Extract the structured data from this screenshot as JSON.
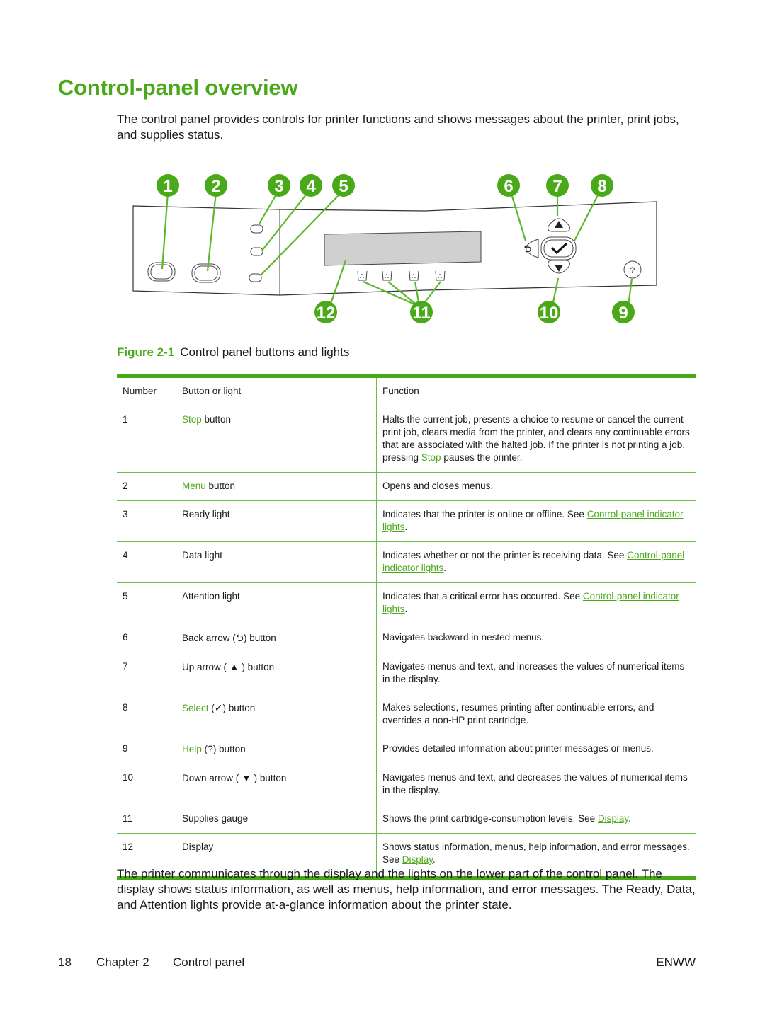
{
  "heading": "Control-panel overview",
  "intro": "The control panel provides controls for printer functions and shows messages about the printer, print jobs, and supplies status.",
  "diagram": {
    "callouts": [
      "1",
      "2",
      "3",
      "4",
      "5",
      "6",
      "7",
      "8",
      "9",
      "10",
      "11",
      "12"
    ],
    "help_symbol": "?"
  },
  "figure": {
    "label": "Figure 2-1",
    "caption": "Control panel buttons and lights"
  },
  "table": {
    "headers": [
      "Number",
      "Button or light",
      "Function"
    ],
    "rows": [
      {
        "num": "1",
        "name_green": "Stop",
        "name_rest": " button",
        "func": "Halts the current job, presents a choice to resume or cancel the current print job, clears media from the printer, and clears any continuable errors that are associated with the halted job. If the printer is not printing a job, pressing ",
        "func_green": "Stop",
        "func_tail": " pauses the printer."
      },
      {
        "num": "2",
        "name_green": "Menu",
        "name_rest": " button",
        "func": "Opens and closes menus."
      },
      {
        "num": "3",
        "name": "Ready light",
        "func": "Indicates that the printer is online or offline. See ",
        "func_link": "Control-panel indicator lights",
        "func_tail": "."
      },
      {
        "num": "4",
        "name": "Data light",
        "func": "Indicates whether or not the printer is receiving data. See ",
        "func_link": "Control-panel indicator lights",
        "func_tail": "."
      },
      {
        "num": "5",
        "name": "Attention light",
        "func": "Indicates that a critical error has occurred. See ",
        "func_link": "Control-panel indicator lights",
        "func_tail": "."
      },
      {
        "num": "6",
        "name_pre": "Back arrow (",
        "glyph": "⮌",
        "name_post": ") button",
        "func": "Navigates backward in nested menus."
      },
      {
        "num": "7",
        "name_pre": "Up arrow ( ",
        "glyph": "▲",
        "name_post": " ) button",
        "func": "Navigates menus and text, and increases the values of numerical items in the display."
      },
      {
        "num": "8",
        "name_green": "Select",
        "name_pre": " (",
        "glyph": "✓",
        "name_post": ") button",
        "func": "Makes selections, resumes printing after continuable errors, and overrides a non-HP print cartridge."
      },
      {
        "num": "9",
        "name_green": "Help",
        "name_pre": " (",
        "glyph": "?",
        "name_post": ") button",
        "func": "Provides detailed information about printer messages or menus."
      },
      {
        "num": "10",
        "name_pre": "Down arrow ( ",
        "glyph": "▼",
        "name_post": " ) button",
        "func": "Navigates menus and text, and decreases the values of numerical items in the display."
      },
      {
        "num": "11",
        "name": "Supplies gauge",
        "func": "Shows the print cartridge-consumption levels. See ",
        "func_link": "Display",
        "func_tail": "."
      },
      {
        "num": "12",
        "name": "Display",
        "func": "Shows status information, menus, help information, and error messages. See ",
        "func_link": "Display",
        "func_tail": "."
      }
    ]
  },
  "outro": "The printer communicates through the display and the lights on the lower part of the control panel. The display shows status information, as well as menus, help information, and error messages. The Ready, Data, and Attention lights provide at-a-glance information about the printer state.",
  "footer": {
    "page": "18",
    "chapter": "Chapter 2",
    "section": "Control panel",
    "edition": "ENWW"
  },
  "colors": {
    "accent_green": "#4aa919",
    "rule_green": "#6cc04a"
  }
}
